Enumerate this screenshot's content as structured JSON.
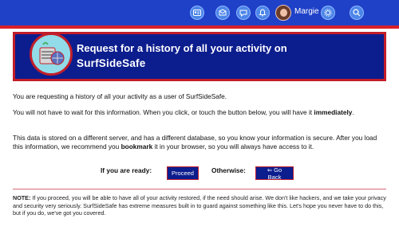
{
  "topnav": {
    "icons": [
      "id-card-icon",
      "inbox-icon",
      "chat-icon",
      "bell-icon"
    ],
    "username": "Margie",
    "settings_icon": "gear-icon",
    "search_icon": "search-icon"
  },
  "banner": {
    "title": "Request for a history of all your activity on",
    "brand": "SurfSideSafe"
  },
  "content": {
    "p1": "You are requesting a history of all your activity as a user of SurfSideSafe.",
    "p2_start": "You will not have to wait for this information. When you click, or touch the button below, you will have it ",
    "p2_bold": "immediately",
    "p2_end": ".",
    "p3_start": "This data is stored on a different server, and has a different database, so you know your information is secure. After you load this information, we recommend you ",
    "p3_bold": "bookmark",
    "p3_end": " it in your browser, so you will always have access to it."
  },
  "actions": {
    "ready_label": "If you are ready:",
    "proceed_button": "Proceed",
    "otherwise_label": "Otherwise:",
    "go_back_button": "⇐ Go Back"
  },
  "note": {
    "label": "NOTE:",
    "text": " If you proceed, you will be able to have all of your activity restored, if the need should arise. We don't like hackers, and we take your privacy and security very seriously. SurfSideSafe has extreme measures built in to guard against something like this. Let's hope you never have to do this, but if you do, we've got you covered."
  },
  "colors": {
    "topbar": "#1f41c8",
    "accent": "#d8202a",
    "banner_bg": "#0c1d8e",
    "button_bg": "#0c1d8e"
  }
}
